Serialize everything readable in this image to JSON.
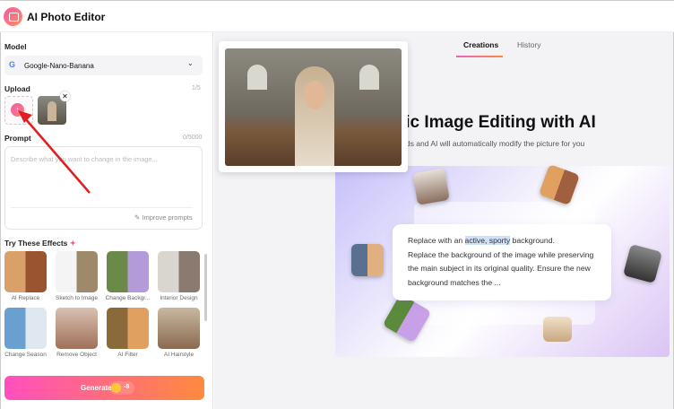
{
  "app": {
    "title": "AI Photo Editor"
  },
  "sidebar": {
    "model_label": "Model",
    "model_value": "Google-Nano-Banana",
    "upload_label": "Upload",
    "upload_count": "1/5",
    "prompt_label": "Prompt",
    "prompt_count": "0/5000",
    "prompt_placeholder": "Describe what you want to change in the image...",
    "improve_label": "Improve prompts",
    "effects_label": "Try These Effects",
    "effects": [
      {
        "label": "AI Replace"
      },
      {
        "label": "Sketch to Image"
      },
      {
        "label": "Change Backgr..."
      },
      {
        "label": "Interior Design"
      },
      {
        "label": "Change Season"
      },
      {
        "label": "Remove Object"
      },
      {
        "label": "AI Filter"
      },
      {
        "label": "AI Hairstyle"
      }
    ],
    "generate_label": "Generate",
    "credits": "-8"
  },
  "main": {
    "tabs": [
      {
        "label": "Creations"
      },
      {
        "label": "History"
      }
    ],
    "heading": "Automatic Image Editing with AI",
    "subtitle": "Enter prompt words and AI will automatically modify the picture for you",
    "demo": {
      "pre": "Replace with an ",
      "highlight": "active, sporty",
      "post": " background.",
      "rest": "Replace the background of the image while preserving the main subject in its original quality. Ensure the new background matches the ..."
    }
  },
  "colors": {
    "accent_start": "#f05fbf",
    "accent_end": "#ff8a3c",
    "annotation": "#e02020"
  }
}
